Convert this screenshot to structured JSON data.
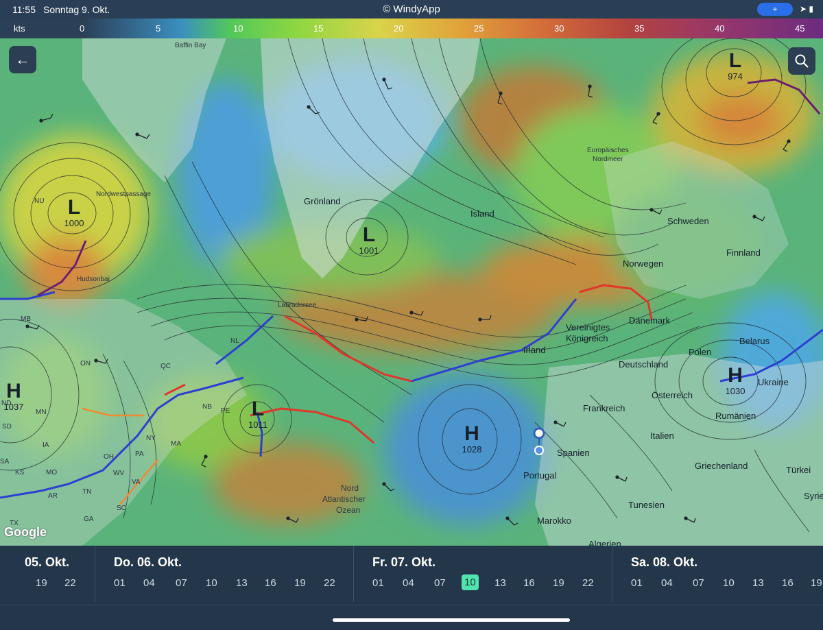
{
  "status": {
    "time": "11:55",
    "date": "Sonntag 9. Okt.",
    "title": "© WindyApp"
  },
  "scale": {
    "unit": "kts",
    "ticks": [
      "0",
      "5",
      "10",
      "15",
      "20",
      "25",
      "30",
      "35",
      "40",
      "45"
    ]
  },
  "map": {
    "back_icon": "arrow-left-icon",
    "search_icon": "search-icon",
    "attribution": "Google",
    "labels": {
      "baffin": "Baffin Bay",
      "nordwest": "Nordwestpassage",
      "nu": "NU",
      "hudson": "Hudsonbai",
      "groenland": "Grönland",
      "island": "Island",
      "euro_nordmeer_1": "Europäisches",
      "euro_nordmeer_2": "Nordmeer",
      "schweden": "Schweden",
      "finnland": "Finnland",
      "norwegen": "Norwegen",
      "labrador": "Labradorsee",
      "vk_1": "Vereinigtes",
      "vk_2": "Königreich",
      "daenemark": "Dänemark",
      "irland": "Irland",
      "belarus": "Belarus",
      "polen": "Polen",
      "deutschland": "Deutschland",
      "ukraine": "Ukraine",
      "oesterreich": "Österreich",
      "frankreich": "Frankreich",
      "rumaenien": "Rumänien",
      "italien": "Italien",
      "spanien": "Spanien",
      "portugal": "Portugal",
      "griechenland": "Griechenland",
      "tuerkei": "Türkei",
      "tunesien": "Tunesien",
      "syrien": "Syrie",
      "marokko": "Marokko",
      "algerien": "Algerien",
      "nordatl_1": "Nord",
      "nordatl_2": "Atlantischer",
      "nordatl_3": "Ozean",
      "mb": "MB",
      "on": "ON",
      "qc": "QC",
      "nl": "NL",
      "nb": "NB",
      "pe": "PE",
      "nd": "ND",
      "sd": "SD",
      "mn": "MN",
      "ia": "IA",
      "ks": "KS",
      "mo": "MO",
      "ar": "AR",
      "tx": "TX",
      "tn": "TN",
      "ga": "GA",
      "sc": "SC",
      "va": "VA",
      "wv": "WV",
      "pa": "PA",
      "oh": "OH",
      "ny": "NY",
      "ma": "MA",
      "sa": "SA"
    },
    "pressure": [
      {
        "type": "L",
        "value": "1000"
      },
      {
        "type": "L",
        "value": "1001"
      },
      {
        "type": "L",
        "value": "974"
      },
      {
        "type": "L",
        "value": "1011"
      },
      {
        "type": "H",
        "value": "1037"
      },
      {
        "type": "H",
        "value": "1028"
      },
      {
        "type": "H",
        "value": "1030"
      }
    ]
  },
  "timeline": {
    "days": [
      {
        "label": "05. Okt.",
        "hours": [
          "19",
          "22"
        ]
      },
      {
        "label": "Do. 06. Okt.",
        "hours": [
          "01",
          "04",
          "07",
          "10",
          "13",
          "16",
          "19",
          "22"
        ]
      },
      {
        "label": "Fr. 07. Okt.",
        "hours": [
          "01",
          "04",
          "07",
          "10",
          "13",
          "16",
          "19",
          "22"
        ],
        "selected": "10"
      },
      {
        "label": "Sa. 08. Okt.",
        "hours": [
          "01",
          "04",
          "07",
          "10",
          "13",
          "16",
          "19"
        ]
      }
    ]
  }
}
